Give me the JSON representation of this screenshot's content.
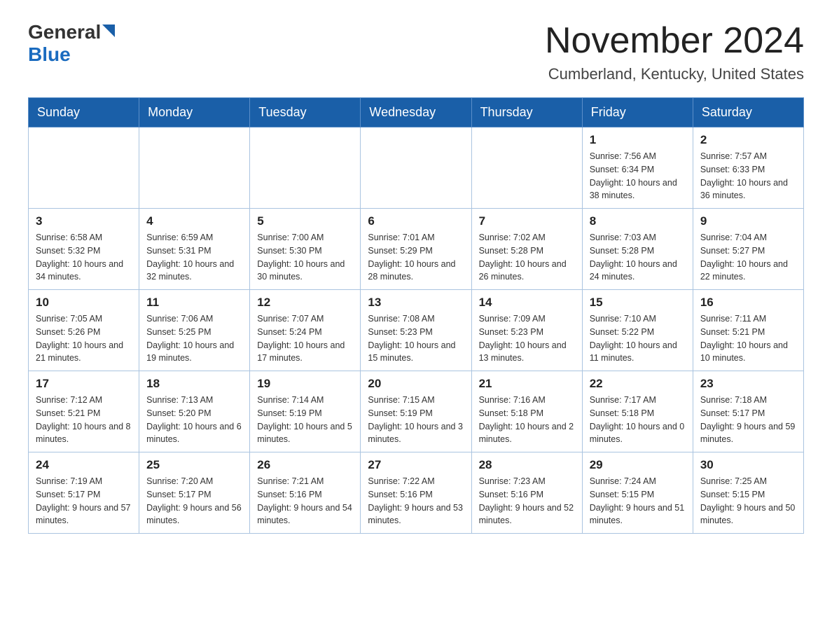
{
  "header": {
    "logo_general": "General",
    "logo_blue": "Blue",
    "title": "November 2024",
    "subtitle": "Cumberland, Kentucky, United States"
  },
  "days_of_week": [
    "Sunday",
    "Monday",
    "Tuesday",
    "Wednesday",
    "Thursday",
    "Friday",
    "Saturday"
  ],
  "weeks": [
    [
      {
        "day": "",
        "info": ""
      },
      {
        "day": "",
        "info": ""
      },
      {
        "day": "",
        "info": ""
      },
      {
        "day": "",
        "info": ""
      },
      {
        "day": "",
        "info": ""
      },
      {
        "day": "1",
        "info": "Sunrise: 7:56 AM\nSunset: 6:34 PM\nDaylight: 10 hours and 38 minutes."
      },
      {
        "day": "2",
        "info": "Sunrise: 7:57 AM\nSunset: 6:33 PM\nDaylight: 10 hours and 36 minutes."
      }
    ],
    [
      {
        "day": "3",
        "info": "Sunrise: 6:58 AM\nSunset: 5:32 PM\nDaylight: 10 hours and 34 minutes."
      },
      {
        "day": "4",
        "info": "Sunrise: 6:59 AM\nSunset: 5:31 PM\nDaylight: 10 hours and 32 minutes."
      },
      {
        "day": "5",
        "info": "Sunrise: 7:00 AM\nSunset: 5:30 PM\nDaylight: 10 hours and 30 minutes."
      },
      {
        "day": "6",
        "info": "Sunrise: 7:01 AM\nSunset: 5:29 PM\nDaylight: 10 hours and 28 minutes."
      },
      {
        "day": "7",
        "info": "Sunrise: 7:02 AM\nSunset: 5:28 PM\nDaylight: 10 hours and 26 minutes."
      },
      {
        "day": "8",
        "info": "Sunrise: 7:03 AM\nSunset: 5:28 PM\nDaylight: 10 hours and 24 minutes."
      },
      {
        "day": "9",
        "info": "Sunrise: 7:04 AM\nSunset: 5:27 PM\nDaylight: 10 hours and 22 minutes."
      }
    ],
    [
      {
        "day": "10",
        "info": "Sunrise: 7:05 AM\nSunset: 5:26 PM\nDaylight: 10 hours and 21 minutes."
      },
      {
        "day": "11",
        "info": "Sunrise: 7:06 AM\nSunset: 5:25 PM\nDaylight: 10 hours and 19 minutes."
      },
      {
        "day": "12",
        "info": "Sunrise: 7:07 AM\nSunset: 5:24 PM\nDaylight: 10 hours and 17 minutes."
      },
      {
        "day": "13",
        "info": "Sunrise: 7:08 AM\nSunset: 5:23 PM\nDaylight: 10 hours and 15 minutes."
      },
      {
        "day": "14",
        "info": "Sunrise: 7:09 AM\nSunset: 5:23 PM\nDaylight: 10 hours and 13 minutes."
      },
      {
        "day": "15",
        "info": "Sunrise: 7:10 AM\nSunset: 5:22 PM\nDaylight: 10 hours and 11 minutes."
      },
      {
        "day": "16",
        "info": "Sunrise: 7:11 AM\nSunset: 5:21 PM\nDaylight: 10 hours and 10 minutes."
      }
    ],
    [
      {
        "day": "17",
        "info": "Sunrise: 7:12 AM\nSunset: 5:21 PM\nDaylight: 10 hours and 8 minutes."
      },
      {
        "day": "18",
        "info": "Sunrise: 7:13 AM\nSunset: 5:20 PM\nDaylight: 10 hours and 6 minutes."
      },
      {
        "day": "19",
        "info": "Sunrise: 7:14 AM\nSunset: 5:19 PM\nDaylight: 10 hours and 5 minutes."
      },
      {
        "day": "20",
        "info": "Sunrise: 7:15 AM\nSunset: 5:19 PM\nDaylight: 10 hours and 3 minutes."
      },
      {
        "day": "21",
        "info": "Sunrise: 7:16 AM\nSunset: 5:18 PM\nDaylight: 10 hours and 2 minutes."
      },
      {
        "day": "22",
        "info": "Sunrise: 7:17 AM\nSunset: 5:18 PM\nDaylight: 10 hours and 0 minutes."
      },
      {
        "day": "23",
        "info": "Sunrise: 7:18 AM\nSunset: 5:17 PM\nDaylight: 9 hours and 59 minutes."
      }
    ],
    [
      {
        "day": "24",
        "info": "Sunrise: 7:19 AM\nSunset: 5:17 PM\nDaylight: 9 hours and 57 minutes."
      },
      {
        "day": "25",
        "info": "Sunrise: 7:20 AM\nSunset: 5:17 PM\nDaylight: 9 hours and 56 minutes."
      },
      {
        "day": "26",
        "info": "Sunrise: 7:21 AM\nSunset: 5:16 PM\nDaylight: 9 hours and 54 minutes."
      },
      {
        "day": "27",
        "info": "Sunrise: 7:22 AM\nSunset: 5:16 PM\nDaylight: 9 hours and 53 minutes."
      },
      {
        "day": "28",
        "info": "Sunrise: 7:23 AM\nSunset: 5:16 PM\nDaylight: 9 hours and 52 minutes."
      },
      {
        "day": "29",
        "info": "Sunrise: 7:24 AM\nSunset: 5:15 PM\nDaylight: 9 hours and 51 minutes."
      },
      {
        "day": "30",
        "info": "Sunrise: 7:25 AM\nSunset: 5:15 PM\nDaylight: 9 hours and 50 minutes."
      }
    ]
  ]
}
